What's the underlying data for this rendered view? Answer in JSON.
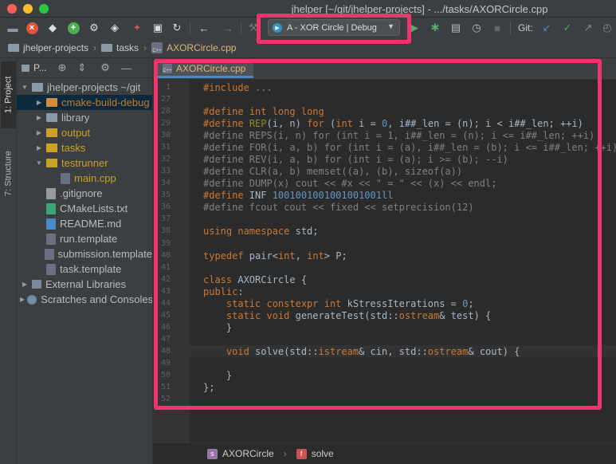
{
  "window": {
    "title": "jhelper [~/git/jhelper-projects] - .../tasks/AXORCircle.cpp"
  },
  "toolbar": {
    "run_config": "A - XOR Circle | Debug",
    "git_label": "Git:",
    "icons": [
      "open-folder-icon",
      "close-red-icon",
      "pin-icon",
      "add-green-icon",
      "gear-icon",
      "bookmark-icon",
      "bug-icon",
      "save-icon",
      "refresh-icon",
      "back-arrow-icon",
      "forward-arrow-icon",
      "hammer-icon",
      "run-icon",
      "debug-icon",
      "coverage-icon",
      "profile-icon",
      "stop-icon",
      "git-update-icon",
      "git-commit-icon",
      "git-push-icon"
    ]
  },
  "breadcrumb": {
    "items": [
      "jhelper-projects",
      "tasks",
      "AXORCircle.cpp"
    ]
  },
  "tool_strip": {
    "project_tab": "1: Project",
    "structure_tab": "7: Structure"
  },
  "project_panel": {
    "header": "P...",
    "tree": [
      {
        "label": "jhelper-projects  ~/git",
        "depth": 0,
        "arrow": "▼",
        "kind": "folder-grey"
      },
      {
        "label": "cmake-build-debug",
        "depth": 1,
        "arrow": "▶",
        "kind": "folder-orange",
        "style": "orange",
        "selected": true
      },
      {
        "label": "library",
        "depth": 1,
        "arrow": "▶",
        "kind": "folder-grey"
      },
      {
        "label": "output",
        "depth": 1,
        "arrow": "▶",
        "kind": "folder-yellow",
        "style": "yellow"
      },
      {
        "label": "tasks",
        "depth": 1,
        "arrow": "▶",
        "kind": "folder-yellow",
        "style": "yellow"
      },
      {
        "label": "testrunner",
        "depth": 1,
        "arrow": "▼",
        "kind": "folder-yellow",
        "style": "yellow"
      },
      {
        "label": "main.cpp",
        "depth": 2,
        "arrow": "",
        "kind": "file-cpp",
        "style": "yellow"
      },
      {
        "label": ".gitignore",
        "depth": 1,
        "arrow": "",
        "kind": "file-plain"
      },
      {
        "label": "CMakeLists.txt",
        "depth": 1,
        "arrow": "",
        "kind": "file-cmake"
      },
      {
        "label": "README.md",
        "depth": 1,
        "arrow": "",
        "kind": "file-md"
      },
      {
        "label": "run.template",
        "depth": 1,
        "arrow": "",
        "kind": "file-cpp"
      },
      {
        "label": "submission.template",
        "depth": 1,
        "arrow": "",
        "kind": "file-cpp"
      },
      {
        "label": "task.template",
        "depth": 1,
        "arrow": "",
        "kind": "file-cpp"
      },
      {
        "label": "External Libraries",
        "depth": 0,
        "arrow": "▶",
        "kind": "lib"
      },
      {
        "label": "Scratches and Consoles",
        "depth": 0,
        "arrow": "▶",
        "kind": "scratch"
      }
    ]
  },
  "editor": {
    "tab_label": "AXORCircle.cpp",
    "lines": [
      {
        "n": "1",
        "html": "<span class='kw'>#include</span> <span class='gry'>...</span>"
      },
      {
        "n": "27",
        "html": ""
      },
      {
        "n": "28",
        "html": "<span class='kw'>#define</span> <span class='kw'>int long long</span>"
      },
      {
        "n": "29",
        "html": "<span class='kw'>#define</span> <span class='mac'>REP</span>(i, n) <span class='kw'>for</span> (<span class='kw'>int</span> i = <span class='num'>0</span>, i##_len = (n); i &lt; i##_len; ++i)"
      },
      {
        "n": "30",
        "html": "<span class='gry'>#define REPS(i, n) for (int i = 1, i##_len = (n); i &lt;= i##_len; ++i)</span>"
      },
      {
        "n": "31",
        "html": "<span class='gry'>#define FOR(i, a, b) for (int i = (a), i##_len = (b); i &lt;= i##_len; ++i)</span>"
      },
      {
        "n": "32",
        "html": "<span class='gry'>#define REV(i, a, b) for (int i = (a); i &gt;= (b); --i)</span>"
      },
      {
        "n": "33",
        "html": "<span class='gry'>#define CLR(a, b) memset((a), (b), sizeof(a))</span>"
      },
      {
        "n": "34",
        "html": "<span class='gry'>#define DUMP(x) cout &lt;&lt; #x &lt;&lt; \" = \" &lt;&lt; (x) &lt;&lt; endl;</span>"
      },
      {
        "n": "35",
        "html": "<span class='kw'>#define</span> INF <span class='num'>1001001001001001001ll</span>"
      },
      {
        "n": "36",
        "html": "<span class='gry'>#define fcout cout &lt;&lt; fixed &lt;&lt; setprecision(12)</span>"
      },
      {
        "n": "37",
        "html": ""
      },
      {
        "n": "38",
        "html": "<span class='kw'>using namespace</span> std;"
      },
      {
        "n": "39",
        "html": ""
      },
      {
        "n": "40",
        "html": "<span class='kw'>typedef</span> pair&lt;<span class='kw'>int</span>, <span class='kw'>int</span>&gt; P;"
      },
      {
        "n": "41",
        "html": ""
      },
      {
        "n": "42",
        "html": "<span class='kw'>class</span> AXORCircle {"
      },
      {
        "n": "43",
        "html": "<span class='kw'>public</span>:"
      },
      {
        "n": "44",
        "html": "    <span class='kw'>static constexpr int</span> kStressIterations = <span class='num'>0</span>;"
      },
      {
        "n": "45",
        "html": "    <span class='kw'>static void</span> generateTest(std::<span class='kw'>ostream</span>&amp; test) {"
      },
      {
        "n": "46",
        "html": "    }"
      },
      {
        "n": "47",
        "html": ""
      },
      {
        "n": "48",
        "html": "    <span class='kw'>void</span> solve(std::<span class='kw'>istream</span>&amp; cin, std::<span class='kw'>ostream</span>&amp; cout) {"
      },
      {
        "n": "49",
        "html": ""
      },
      {
        "n": "50",
        "html": "    }"
      },
      {
        "n": "51",
        "html": "};"
      },
      {
        "n": "52",
        "html": ""
      }
    ]
  },
  "structure_bar": {
    "class_badge": "s",
    "class_name": "AXORCircle",
    "fn_badge": "f",
    "fn_name": "solve"
  },
  "colors": {
    "highlight": "#f2346c",
    "accent": "#3592c4"
  }
}
